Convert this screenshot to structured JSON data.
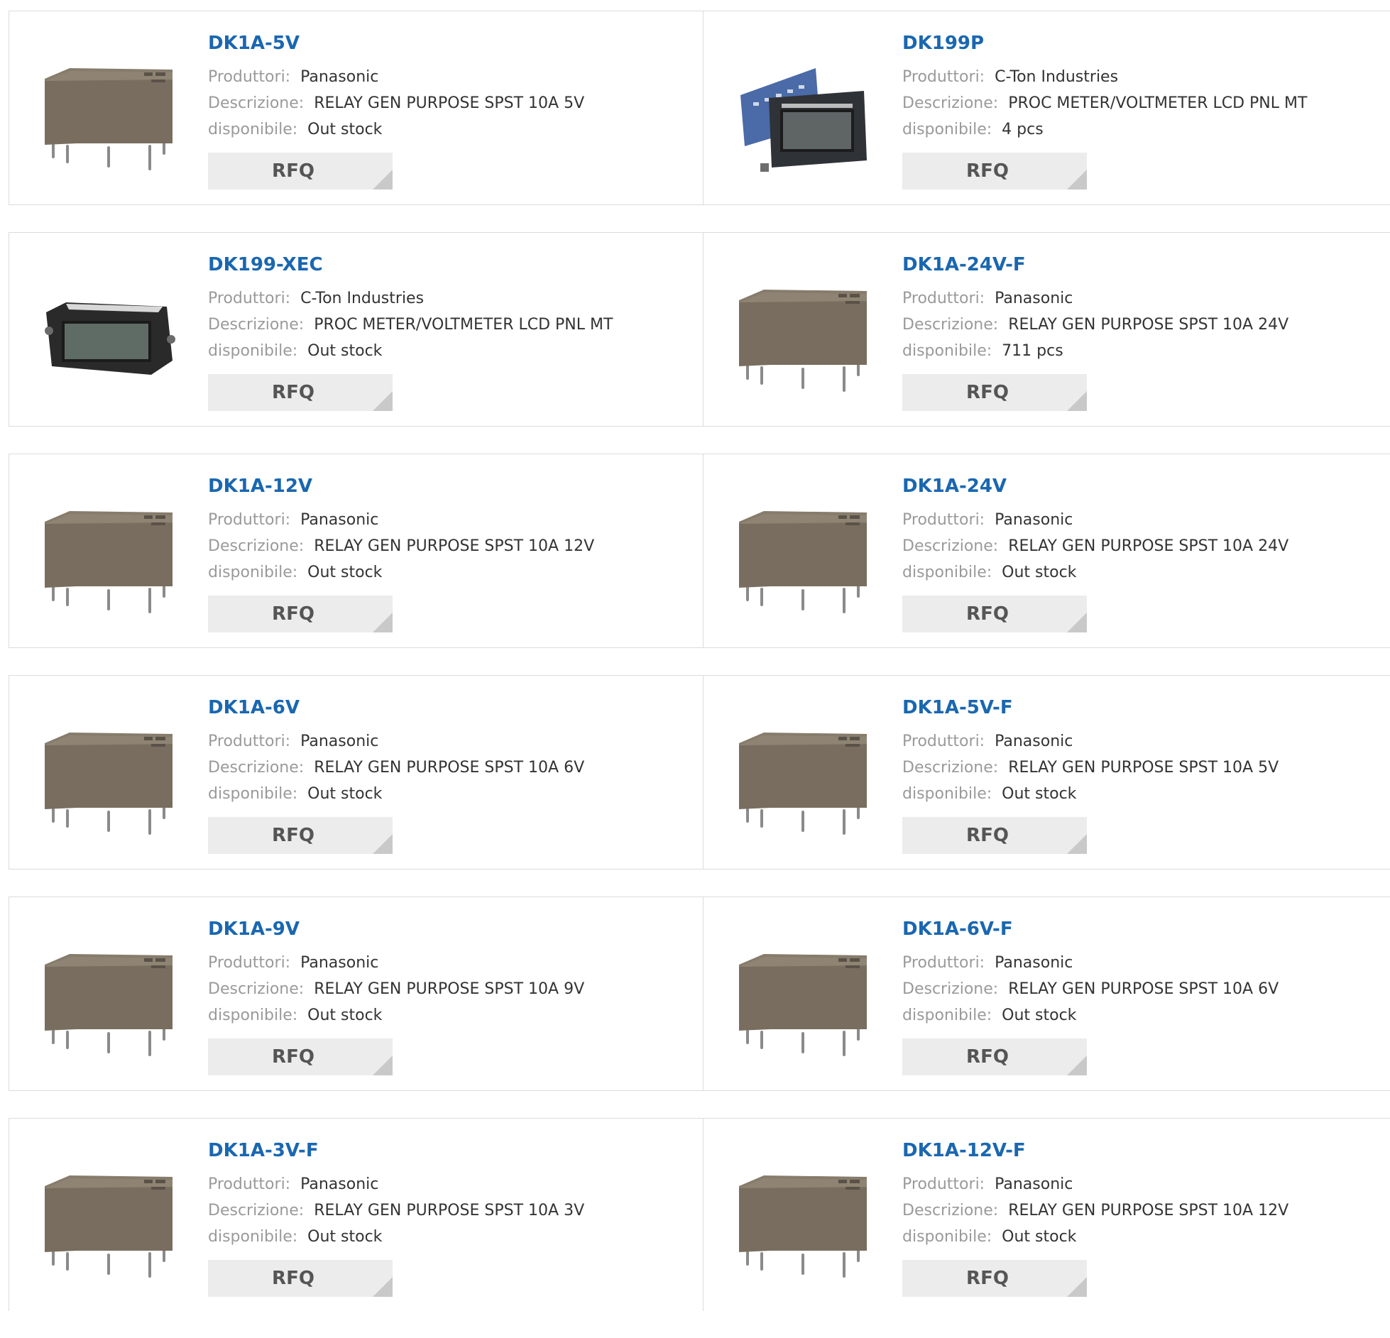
{
  "labels": {
    "manufacturer": "Produttori:",
    "description": "Descrizione:",
    "availability": "disponibile:",
    "rfq": "RFQ"
  },
  "products": [
    {
      "part": "DK1A-5V",
      "manufacturer": "Panasonic",
      "description": "RELAY GEN PURPOSE SPST 10A 5V",
      "availability": "Out stock",
      "image": "relay-icon"
    },
    {
      "part": "DK199P",
      "manufacturer": "C-Ton Industries",
      "description": "PROC METER/VOLTMETER LCD PNL MT",
      "availability": "4 pcs",
      "image": "panel-meter-board-icon"
    },
    {
      "part": "DK199-XEC",
      "manufacturer": "C-Ton Industries",
      "description": "PROC METER/VOLTMETER LCD PNL MT",
      "availability": "Out stock",
      "image": "panel-meter-icon"
    },
    {
      "part": "DK1A-24V-F",
      "manufacturer": "Panasonic",
      "description": "RELAY GEN PURPOSE SPST 10A 24V",
      "availability": "711 pcs",
      "image": "relay-icon"
    },
    {
      "part": "DK1A-12V",
      "manufacturer": "Panasonic",
      "description": "RELAY GEN PURPOSE SPST 10A 12V",
      "availability": "Out stock",
      "image": "relay-icon"
    },
    {
      "part": "DK1A-24V",
      "manufacturer": "Panasonic",
      "description": "RELAY GEN PURPOSE SPST 10A 24V",
      "availability": "Out stock",
      "image": "relay-icon"
    },
    {
      "part": "DK1A-6V",
      "manufacturer": "Panasonic",
      "description": "RELAY GEN PURPOSE SPST 10A 6V",
      "availability": "Out stock",
      "image": "relay-icon"
    },
    {
      "part": "DK1A-5V-F",
      "manufacturer": "Panasonic",
      "description": "RELAY GEN PURPOSE SPST 10A 5V",
      "availability": "Out stock",
      "image": "relay-icon"
    },
    {
      "part": "DK1A-9V",
      "manufacturer": "Panasonic",
      "description": "RELAY GEN PURPOSE SPST 10A 9V",
      "availability": "Out stock",
      "image": "relay-icon"
    },
    {
      "part": "DK1A-6V-F",
      "manufacturer": "Panasonic",
      "description": "RELAY GEN PURPOSE SPST 10A 6V",
      "availability": "Out stock",
      "image": "relay-icon"
    },
    {
      "part": "DK1A-3V-F",
      "manufacturer": "Panasonic",
      "description": "RELAY GEN PURPOSE SPST 10A 3V",
      "availability": "Out stock",
      "image": "relay-icon"
    },
    {
      "part": "DK1A-12V-F",
      "manufacturer": "Panasonic",
      "description": "RELAY GEN PURPOSE SPST 10A 12V",
      "availability": "Out stock",
      "image": "relay-icon"
    }
  ],
  "colors": {
    "link": "#1a67b0",
    "label": "#9a9a9a",
    "value": "#333333",
    "button_bg": "#ececec",
    "border": "#dcdcdc"
  }
}
